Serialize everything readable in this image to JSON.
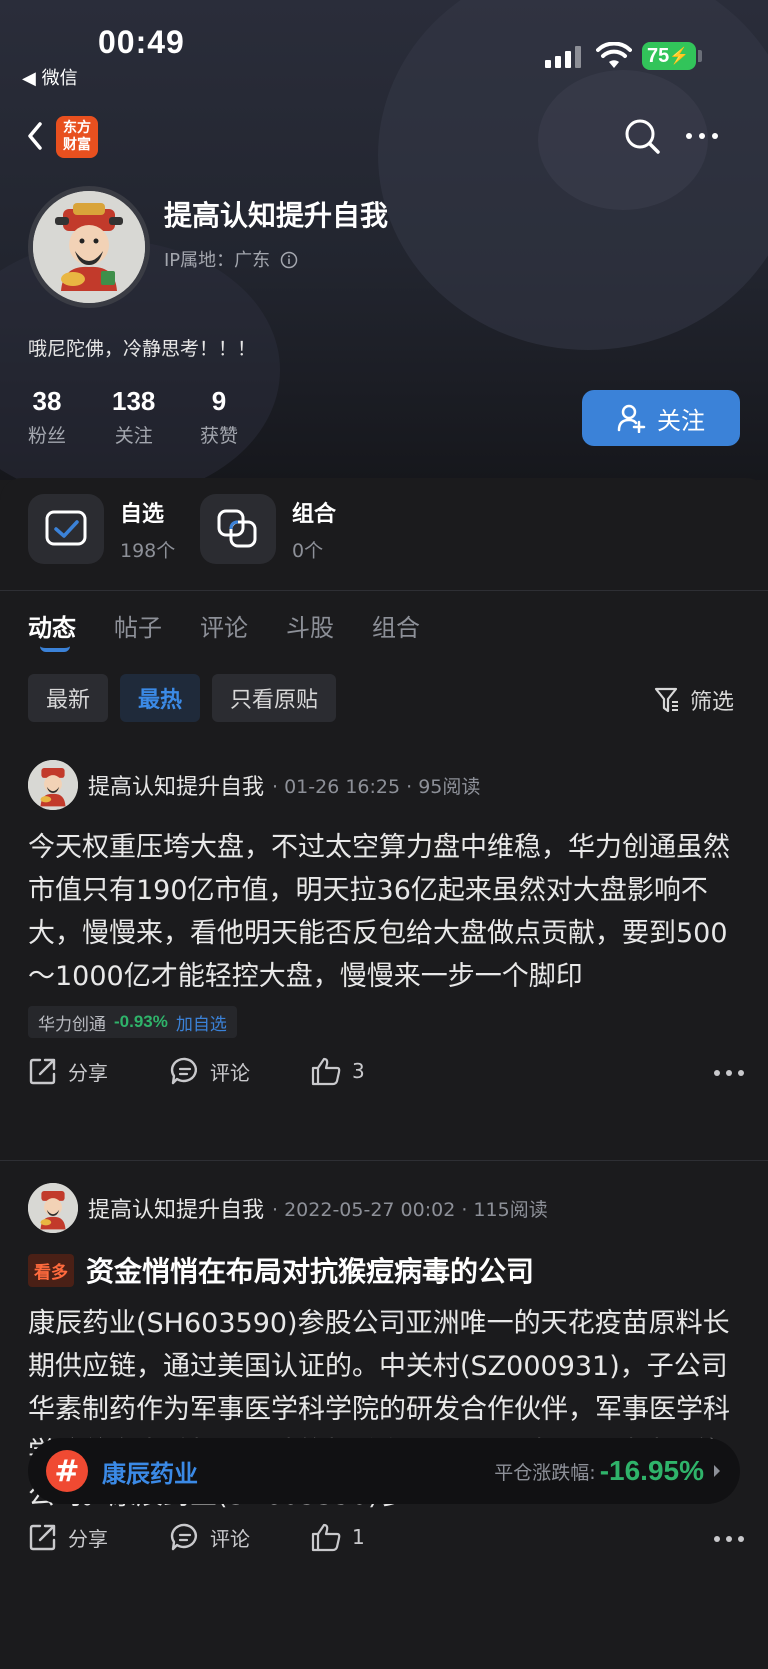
{
  "status": {
    "time": "00:49",
    "back_app": "◀ 微信",
    "battery": "75"
  },
  "nav": {
    "logo_line1": "东方",
    "logo_line2": "财富"
  },
  "profile": {
    "name": "提高认知提升自我",
    "ip": "IP属地：广东",
    "bio": "哦尼陀佛，冷静思考！！！",
    "stats": [
      {
        "num": "38",
        "label": "粉丝"
      },
      {
        "num": "138",
        "label": "关注"
      },
      {
        "num": "9",
        "label": "获赞"
      }
    ],
    "follow_label": "关注"
  },
  "shortcuts": [
    {
      "title": "自选",
      "sub": "198个"
    },
    {
      "title": "组合",
      "sub": "0个"
    }
  ],
  "tabs": [
    "动态",
    "帖子",
    "评论",
    "斗股",
    "组合"
  ],
  "filters": [
    "最新",
    "最热",
    "只看原贴"
  ],
  "filter_btn": "筛选",
  "posts": [
    {
      "author": "提高认知提升自我",
      "meta": "· 01-26 16:25 · 95阅读",
      "body": "今天权重压垮大盘，不过太空算力盘中维稳，华力创通虽然市值只有190亿市值，明天拉36亿起来虽然对大盘影响不大，慢慢来，看他明天能否反包给大盘做点贡献，要到500～1000亿才能轻控大盘，慢慢来一步一个脚印",
      "stock_name": "华力创通",
      "stock_change": "-0.93%",
      "add_label": "加自选",
      "share": "分享",
      "comment": "评论",
      "likes": "3"
    },
    {
      "author": "提高认知提升自我",
      "meta": "· 2022-05-27 00:02 · 115阅读",
      "badge": "看多",
      "title": "资金悄悄在布局对抗猴痘病毒的公司",
      "body": "康辰药业(SH603590)参股公司亚洲唯一的天花疫苗原料长期供应链，通过美国认证的。中关村(SZ000931)，子公司华素制药作为军事医学科学院的研发合作伙伴，军事医学科学院曾发表过特考韦瑞的相关专利，A股与特考韦瑞沾边的公司。康辰药业(SH603590)参…",
      "card_stock": "康辰药业",
      "card_label": "平仓涨跌幅:",
      "card_value": "-16.95%",
      "share": "分享",
      "comment": "评论",
      "likes": "1"
    }
  ],
  "colors": {
    "accent": "#3b82d8",
    "down": "#2fb36a",
    "hot": "#f04a32"
  }
}
